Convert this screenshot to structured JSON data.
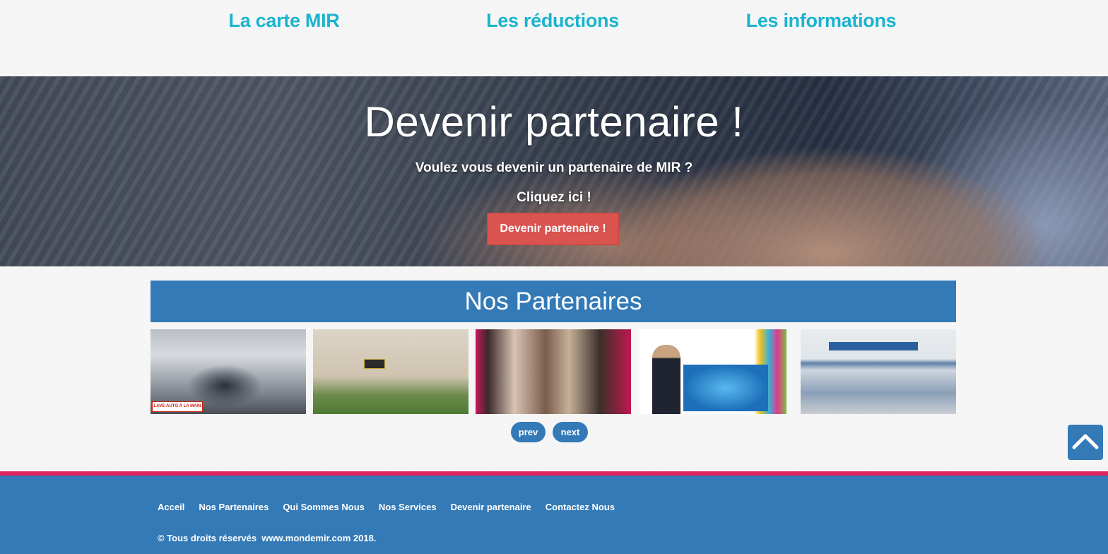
{
  "top_links": {
    "card": "La carte MIR",
    "discounts": "Les réductions",
    "information": "Les informations"
  },
  "hero": {
    "title": "Devenir partenaire !",
    "subtitle": "Voulez vous devenir un partenaire de MIR ?",
    "cta_text": "Cliquez ici !",
    "button_label": "Devenir partenaire !",
    "button_color": "#d9534f"
  },
  "partners": {
    "heading": "Nos Partenaires",
    "images": [
      {
        "name": "car-wash",
        "badge": "LAVE-AUTO À LA MAIN"
      },
      {
        "name": "hotel-building"
      },
      {
        "name": "clothing-store"
      },
      {
        "name": "training-poster"
      },
      {
        "name": "laboratory"
      }
    ],
    "prev_label": "prev",
    "next_label": "next"
  },
  "scroll_top": {
    "icon": "chevron-up-icon"
  },
  "footer": {
    "links": [
      "Acceil",
      "Nos Partenaires",
      "Qui Sommes Nous",
      "Nos Services",
      "Devenir partenaire",
      "Contactez Nous"
    ],
    "copyright": "© Tous droits réservés  www.mondemir.com 2018."
  },
  "colors": {
    "accent_cyan": "#1ab4cf",
    "primary_blue": "#337ab7",
    "footer_stripe": "#e0245e"
  }
}
